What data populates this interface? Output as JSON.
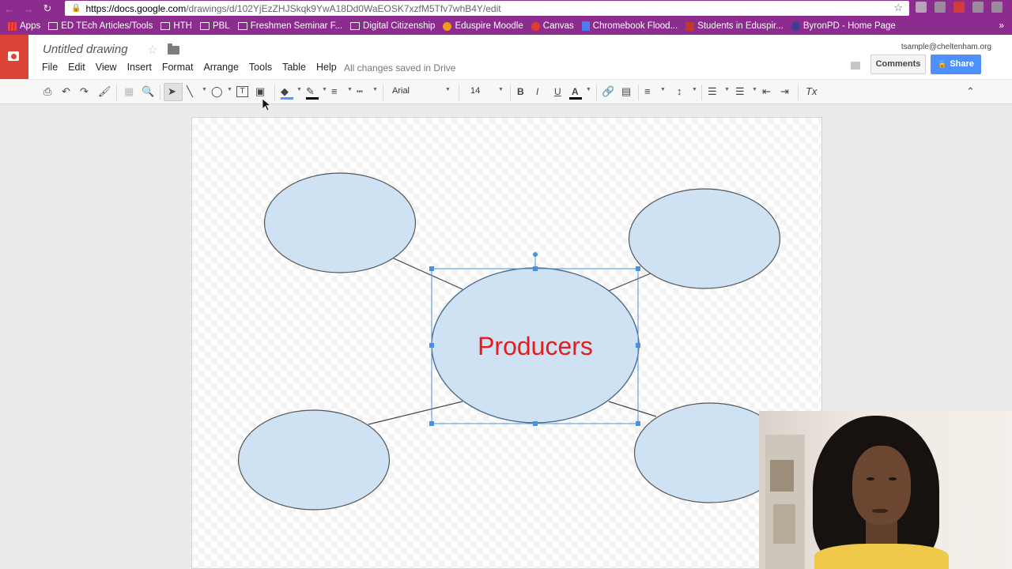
{
  "browser": {
    "url_host": "https://docs.google.com",
    "url_path": "/drawings/d/102YjEzZHJSkqk9YwA18Dd0WaEOSK7xzfM5Tfv7whB4Y/edit",
    "bookmarks": [
      {
        "label": "Apps",
        "icon": "apps-grid-icon"
      },
      {
        "label": "ED TEch Articles/Tools",
        "icon": "folder-icon"
      },
      {
        "label": "HTH",
        "icon": "folder-icon"
      },
      {
        "label": "PBL",
        "icon": "folder-icon"
      },
      {
        "label": "Freshmen Seminar F...",
        "icon": "folder-icon"
      },
      {
        "label": "Digital Citizenship",
        "icon": "folder-icon"
      },
      {
        "label": "Eduspire Moodle",
        "icon": "moodle-icon"
      },
      {
        "label": "Canvas",
        "icon": "canvas-icon"
      },
      {
        "label": "Chromebook Flood...",
        "icon": "doc-icon"
      },
      {
        "label": "Students in Eduspir...",
        "icon": "person-icon"
      },
      {
        "label": "ByronPD - Home Page",
        "icon": "site-icon"
      }
    ],
    "more": "»"
  },
  "app": {
    "title": "Untitled drawing",
    "menu": [
      "File",
      "Edit",
      "View",
      "Insert",
      "Format",
      "Arrange",
      "Tools",
      "Table",
      "Help"
    ],
    "saved_status": "All changes saved in Drive",
    "account": "tsample@cheltenham.org",
    "comments_label": "Comments",
    "share_label": "Share"
  },
  "toolbar": {
    "font": "Arial",
    "font_size": "14",
    "bold": "B",
    "italic": "I",
    "underline": "U",
    "text_color_letter": "A",
    "clear_format": "Tx",
    "accent_fill_color": "#5b95f9",
    "line_color": "#000000",
    "text_color": "#000000"
  },
  "drawing": {
    "center_label": "Producers",
    "center_label_color": "#e51c1c",
    "ellipse_fill": "#cfe2f3",
    "ellipse_stroke": "#555555",
    "selection_color": "#4a90e2"
  },
  "colors": {
    "chrome_purple": "#8c2c8e",
    "logo_red": "#db4437",
    "share_blue": "#4d90fe"
  }
}
